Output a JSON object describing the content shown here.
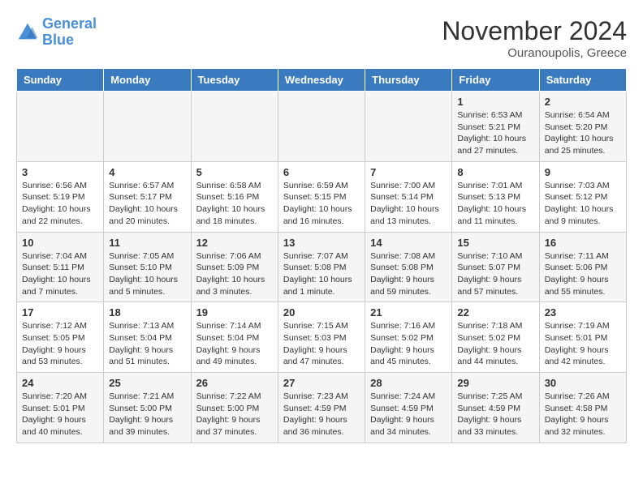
{
  "header": {
    "logo_line1": "General",
    "logo_line2": "Blue",
    "month": "November 2024",
    "location": "Ouranoupolis, Greece"
  },
  "days_of_week": [
    "Sunday",
    "Monday",
    "Tuesday",
    "Wednesday",
    "Thursday",
    "Friday",
    "Saturday"
  ],
  "weeks": [
    [
      {
        "day": "",
        "info": ""
      },
      {
        "day": "",
        "info": ""
      },
      {
        "day": "",
        "info": ""
      },
      {
        "day": "",
        "info": ""
      },
      {
        "day": "",
        "info": ""
      },
      {
        "day": "1",
        "info": "Sunrise: 6:53 AM\nSunset: 5:21 PM\nDaylight: 10 hours and 27 minutes."
      },
      {
        "day": "2",
        "info": "Sunrise: 6:54 AM\nSunset: 5:20 PM\nDaylight: 10 hours and 25 minutes."
      }
    ],
    [
      {
        "day": "3",
        "info": "Sunrise: 6:56 AM\nSunset: 5:19 PM\nDaylight: 10 hours and 22 minutes."
      },
      {
        "day": "4",
        "info": "Sunrise: 6:57 AM\nSunset: 5:17 PM\nDaylight: 10 hours and 20 minutes."
      },
      {
        "day": "5",
        "info": "Sunrise: 6:58 AM\nSunset: 5:16 PM\nDaylight: 10 hours and 18 minutes."
      },
      {
        "day": "6",
        "info": "Sunrise: 6:59 AM\nSunset: 5:15 PM\nDaylight: 10 hours and 16 minutes."
      },
      {
        "day": "7",
        "info": "Sunrise: 7:00 AM\nSunset: 5:14 PM\nDaylight: 10 hours and 13 minutes."
      },
      {
        "day": "8",
        "info": "Sunrise: 7:01 AM\nSunset: 5:13 PM\nDaylight: 10 hours and 11 minutes."
      },
      {
        "day": "9",
        "info": "Sunrise: 7:03 AM\nSunset: 5:12 PM\nDaylight: 10 hours and 9 minutes."
      }
    ],
    [
      {
        "day": "10",
        "info": "Sunrise: 7:04 AM\nSunset: 5:11 PM\nDaylight: 10 hours and 7 minutes."
      },
      {
        "day": "11",
        "info": "Sunrise: 7:05 AM\nSunset: 5:10 PM\nDaylight: 10 hours and 5 minutes."
      },
      {
        "day": "12",
        "info": "Sunrise: 7:06 AM\nSunset: 5:09 PM\nDaylight: 10 hours and 3 minutes."
      },
      {
        "day": "13",
        "info": "Sunrise: 7:07 AM\nSunset: 5:08 PM\nDaylight: 10 hours and 1 minute."
      },
      {
        "day": "14",
        "info": "Sunrise: 7:08 AM\nSunset: 5:08 PM\nDaylight: 9 hours and 59 minutes."
      },
      {
        "day": "15",
        "info": "Sunrise: 7:10 AM\nSunset: 5:07 PM\nDaylight: 9 hours and 57 minutes."
      },
      {
        "day": "16",
        "info": "Sunrise: 7:11 AM\nSunset: 5:06 PM\nDaylight: 9 hours and 55 minutes."
      }
    ],
    [
      {
        "day": "17",
        "info": "Sunrise: 7:12 AM\nSunset: 5:05 PM\nDaylight: 9 hours and 53 minutes."
      },
      {
        "day": "18",
        "info": "Sunrise: 7:13 AM\nSunset: 5:04 PM\nDaylight: 9 hours and 51 minutes."
      },
      {
        "day": "19",
        "info": "Sunrise: 7:14 AM\nSunset: 5:04 PM\nDaylight: 9 hours and 49 minutes."
      },
      {
        "day": "20",
        "info": "Sunrise: 7:15 AM\nSunset: 5:03 PM\nDaylight: 9 hours and 47 minutes."
      },
      {
        "day": "21",
        "info": "Sunrise: 7:16 AM\nSunset: 5:02 PM\nDaylight: 9 hours and 45 minutes."
      },
      {
        "day": "22",
        "info": "Sunrise: 7:18 AM\nSunset: 5:02 PM\nDaylight: 9 hours and 44 minutes."
      },
      {
        "day": "23",
        "info": "Sunrise: 7:19 AM\nSunset: 5:01 PM\nDaylight: 9 hours and 42 minutes."
      }
    ],
    [
      {
        "day": "24",
        "info": "Sunrise: 7:20 AM\nSunset: 5:01 PM\nDaylight: 9 hours and 40 minutes."
      },
      {
        "day": "25",
        "info": "Sunrise: 7:21 AM\nSunset: 5:00 PM\nDaylight: 9 hours and 39 minutes."
      },
      {
        "day": "26",
        "info": "Sunrise: 7:22 AM\nSunset: 5:00 PM\nDaylight: 9 hours and 37 minutes."
      },
      {
        "day": "27",
        "info": "Sunrise: 7:23 AM\nSunset: 4:59 PM\nDaylight: 9 hours and 36 minutes."
      },
      {
        "day": "28",
        "info": "Sunrise: 7:24 AM\nSunset: 4:59 PM\nDaylight: 9 hours and 34 minutes."
      },
      {
        "day": "29",
        "info": "Sunrise: 7:25 AM\nSunset: 4:59 PM\nDaylight: 9 hours and 33 minutes."
      },
      {
        "day": "30",
        "info": "Sunrise: 7:26 AM\nSunset: 4:58 PM\nDaylight: 9 hours and 32 minutes."
      }
    ]
  ]
}
